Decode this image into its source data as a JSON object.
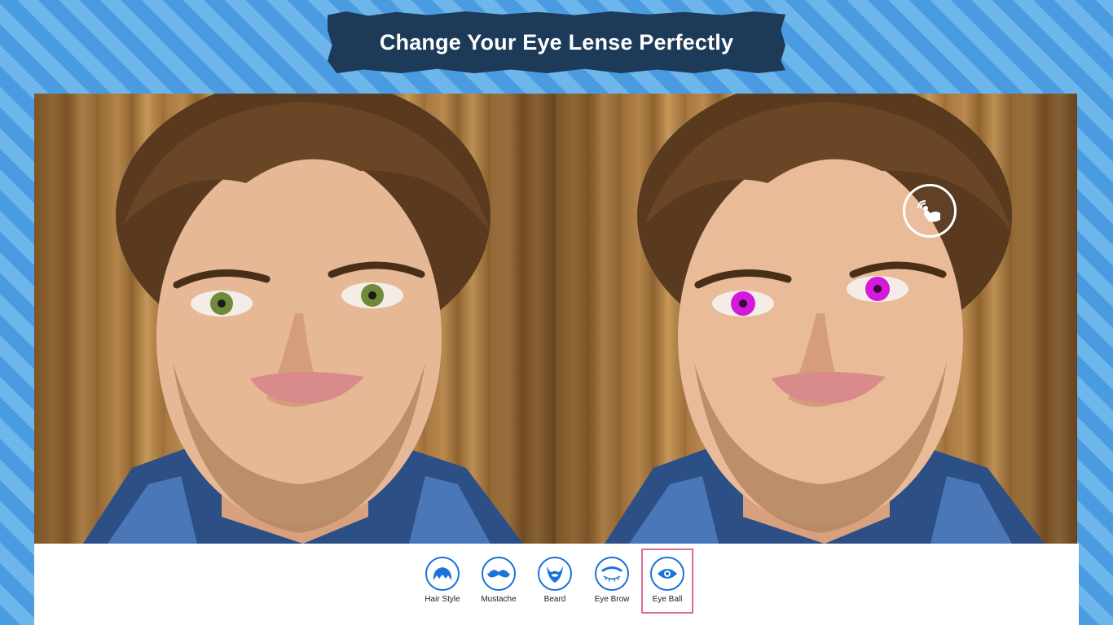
{
  "banner": {
    "title": "Change Your Eye Lense Perfectly"
  },
  "colors": {
    "accent_blue": "#1a73d6",
    "banner_bg": "#1d3a58",
    "selected_border": "#d96a9a",
    "eye_original": "#6e8a3a",
    "eye_changed": "#d21ad8"
  },
  "photos": {
    "before": {
      "eye_color_name": "original"
    },
    "after": {
      "eye_color_name": "magenta"
    }
  },
  "touch_hint": {
    "icon": "touch-tap-icon"
  },
  "toolbar": {
    "selected": "Eye Ball",
    "items": [
      {
        "label": "Hair Style",
        "icon": "hair-style-icon"
      },
      {
        "label": "Mustache",
        "icon": "mustache-icon"
      },
      {
        "label": "Beard",
        "icon": "beard-icon"
      },
      {
        "label": "Eye Brow",
        "icon": "eye-brow-icon"
      },
      {
        "label": "Eye Ball",
        "icon": "eye-ball-icon"
      }
    ]
  }
}
